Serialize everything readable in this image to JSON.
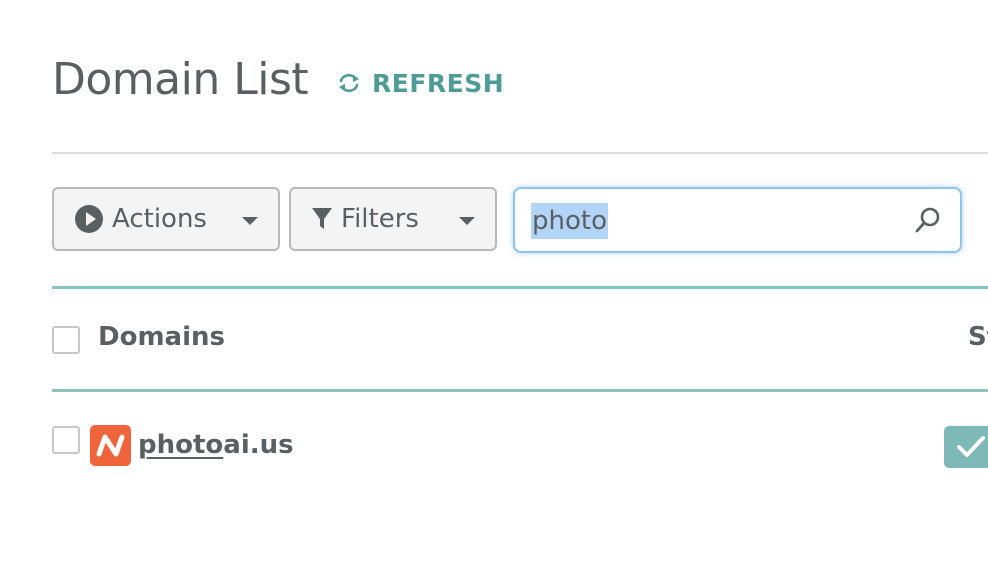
{
  "page": {
    "title": "Domain List",
    "refresh_label": "REFRESH"
  },
  "toolbar": {
    "actions_label": "Actions",
    "filters_label": "Filters",
    "search_value": "photo",
    "search_placeholder": ""
  },
  "table": {
    "columns": [
      "Domains",
      "St"
    ],
    "rows": [
      {
        "domain_match": "photo",
        "domain_rest": "ai.us",
        "status_icon": "check-icon"
      }
    ]
  },
  "colors": {
    "accent": "#4f9b96",
    "table_rule": "#8cc1c0",
    "favicon": "#f0643c",
    "status": "#7eb9b8"
  }
}
